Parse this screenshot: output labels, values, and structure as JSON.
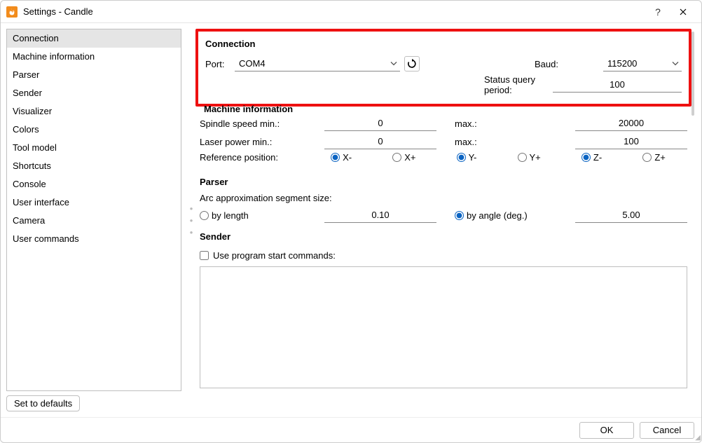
{
  "window": {
    "title": "Settings - Candle"
  },
  "sidebar": {
    "items": [
      "Connection",
      "Machine information",
      "Parser",
      "Sender",
      "Visualizer",
      "Colors",
      "Tool model",
      "Shortcuts",
      "Console",
      "User interface",
      "Camera",
      "User commands"
    ],
    "selected_index": 0
  },
  "buttons": {
    "defaults": "Set to defaults",
    "ok": "OK",
    "cancel": "Cancel"
  },
  "sections": {
    "connection": {
      "title": "Connection",
      "port_label": "Port:",
      "port_value": "COM4",
      "baud_label": "Baud:",
      "baud_value": "115200",
      "sq_label": "Status query period:",
      "sq_value": "100"
    },
    "machine": {
      "title": "Machine information",
      "spindle_min_label": "Spindle speed min.:",
      "spindle_min_value": "0",
      "spindle_max_label": "max.:",
      "spindle_max_value": "20000",
      "laser_min_label": "Laser power min.:",
      "laser_min_value": "0",
      "laser_max_label": "max.:",
      "laser_max_value": "100",
      "refpos_label": "Reference position:",
      "refpos_options": [
        "X-",
        "X+",
        "Y-",
        "Y+",
        "Z-",
        "Z+"
      ],
      "refpos_selected": [
        "X-",
        "Y-",
        "Z-"
      ]
    },
    "parser": {
      "title": "Parser",
      "arc_label": "Arc approximation segment size:",
      "by_length_label": "by length",
      "by_length_value": "0.10",
      "by_angle_label": "by angle (deg.)",
      "by_angle_value": "5.00",
      "selected": "by_angle"
    },
    "sender": {
      "title": "Sender",
      "use_start_label": "Use program start commands:",
      "use_start_checked": false
    }
  }
}
